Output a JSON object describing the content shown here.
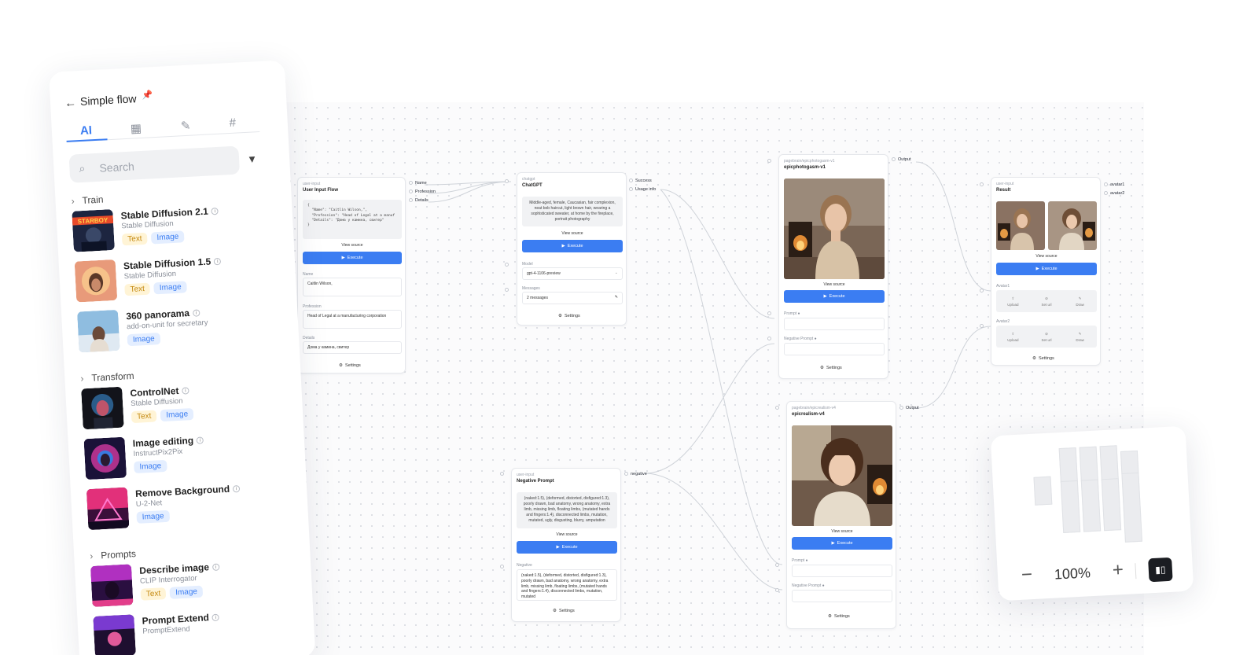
{
  "panel": {
    "title": "Simple flow",
    "tabs": [
      "AI",
      "▦",
      "✎",
      "#"
    ],
    "search_placeholder": "Search",
    "sections": {
      "train": "Train",
      "transform": "Transform",
      "prompts": "Prompts"
    },
    "train_items": [
      {
        "name": "Stable Diffusion 2.1",
        "sub": "Stable Diffusion",
        "tags": [
          "Text",
          "Image"
        ]
      },
      {
        "name": "Stable Diffusion 1.5",
        "sub": "Stable Diffusion",
        "tags": [
          "Text",
          "Image"
        ]
      },
      {
        "name": "360 panorama",
        "sub": "add-on-unit for secretary",
        "tags": [
          "Image"
        ]
      }
    ],
    "transform_items": [
      {
        "name": "ControlNet",
        "sub": "Stable Diffusion",
        "tags": [
          "Text",
          "Image"
        ]
      },
      {
        "name": "Image editing",
        "sub": "InstructPix2Pix",
        "tags": [
          "Image"
        ]
      },
      {
        "name": "Remove Background",
        "sub": "U-2-Net",
        "tags": [
          "Image"
        ]
      }
    ],
    "prompt_items": [
      {
        "name": "Describe image",
        "sub": "CLIP Interrogator",
        "tags": [
          "Text",
          "Image"
        ]
      },
      {
        "name": "Prompt Extend",
        "sub": "PromptExtend",
        "tags": []
      }
    ],
    "thumb_texts": {
      "stardust": "STARBOY"
    }
  },
  "nodes": {
    "user_input": {
      "kind": "user-input",
      "title": "User Input Flow",
      "code": "{\n  \"Name\": \"Caitlin Wilson,\",\n  \"Profession\": \"Head of Legal at a manuf\n  \"Details\": \"Дома у камина, свитер\"\n}",
      "view_source": "View source",
      "execute": "Execute",
      "fields": [
        {
          "label": "Name",
          "value": "Caitlin Wilson,"
        },
        {
          "label": "Profession",
          "value": "Head of Legal at a manufacturing corporation"
        },
        {
          "label": "Details",
          "value": "Дома у камина, свитер"
        }
      ],
      "settings": "Settings",
      "outputs": [
        "Name",
        "Profession",
        "Details"
      ]
    },
    "chatgpt": {
      "kind": "chatgpt",
      "title": "ChatGPT",
      "text": "Middle-aged, female, Caucasian, fair complexion, neat bob haircut, light brown hair, wearing a sophisticated sweater, at home by the fireplace, portrait photography",
      "view_source": "View source",
      "execute": "Execute",
      "model_label": "Model",
      "model_value": "gpt-4-1106-preview",
      "messages_label": "Messages",
      "messages_value": "2 messages",
      "settings": "Settings",
      "outputs": [
        "Success",
        "Usage info"
      ]
    },
    "epicphotogasm": {
      "kind": "pagebrain/epicphotogasm-v1",
      "title": "epicphotogasm-v1",
      "view_source": "View source",
      "execute": "Execute",
      "prompt_label": "Prompt",
      "neg_label": "Negative Prompt",
      "settings": "Settings",
      "output": "Output"
    },
    "epicrealism": {
      "kind": "pagebrain/epicrealism-v4",
      "title": "epicrealism-v4",
      "view_source": "View source",
      "execute": "Execute",
      "prompt_label": "Prompt",
      "neg_label": "Negative Prompt",
      "settings": "Settings",
      "output": "Output"
    },
    "result": {
      "kind": "user-input",
      "title": "Result",
      "view_source": "View source",
      "execute": "Execute",
      "avatar1_label": "Avatar1",
      "avatar2_label": "Avatar2",
      "actions": [
        "Upload",
        "Set url",
        "Draw"
      ],
      "settings": "Settings",
      "outputs": [
        "avatar1",
        "avatar2"
      ]
    },
    "negative": {
      "kind": "user-input",
      "title": "Negative Prompt",
      "text": "(naked:1.5), (deformed, distorted, disfigured:1.3), poorly drawn, bad anatomy, wrong anatomy, extra limb, missing limb, floating limbs, (mutated hands and fingers:1.4), disconnected limbs, mutation, mutated, ugly, disgusting, blurry, amputation",
      "view_source": "View source",
      "execute": "Execute",
      "field_label": "Negative",
      "field_value": "(naked:1.5), (deformed, distorted, disfigured:1.3), poorly drawn, bad anatomy, wrong anatomy, extra limb, missing limb, floating limbs, (mutated hands and fingers:1.4), disconnected limbs, mutation, mutated",
      "settings": "Settings",
      "output": "negative"
    }
  },
  "zoom": {
    "value": "100%",
    "minus": "−",
    "plus": "+"
  },
  "colors": {
    "accent": "#3b7df2",
    "text_tag_bg": "#fff4d6",
    "image_tag_bg": "#e4eeff"
  }
}
